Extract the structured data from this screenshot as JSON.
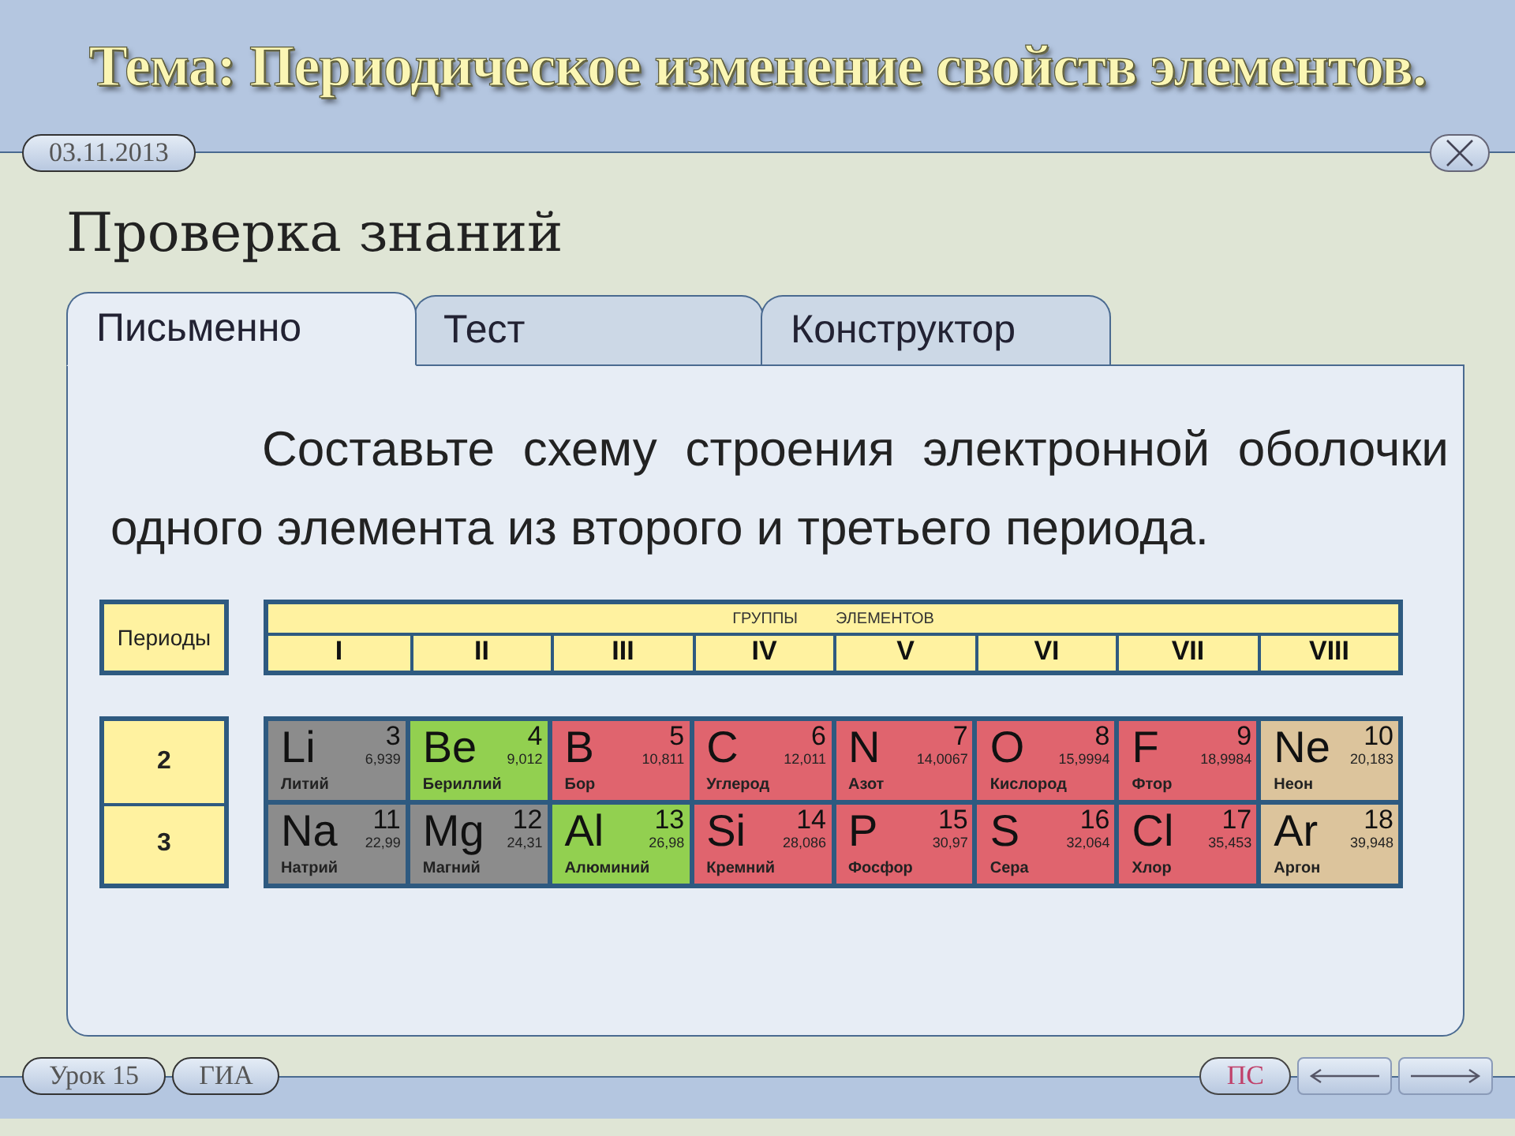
{
  "header": {
    "title": "Тема: Периодическое изменение свойств элементов.",
    "date": "03.11.2013"
  },
  "heading": "Проверка знаний",
  "tabs": [
    {
      "label": "Письменно",
      "selected": true
    },
    {
      "label": "Тест",
      "selected": false
    },
    {
      "label": "Конструктор",
      "selected": false
    }
  ],
  "task": "Составьте схему строения электронной оболочки одного элемента из второго и третьего периода.",
  "table": {
    "periods_label": "Периоды",
    "groups_title": [
      "ГРУППЫ",
      "ЭЛЕМЕНТОВ"
    ],
    "groups": [
      "I",
      "II",
      "III",
      "IV",
      "V",
      "VI",
      "VII",
      "VIII"
    ],
    "periods": [
      "2",
      "3"
    ],
    "elements": [
      [
        {
          "symbol": "Li",
          "number": "3",
          "mass": "6,939",
          "name": "Литий",
          "color": "#8c8c8c"
        },
        {
          "symbol": "Be",
          "number": "4",
          "mass": "9,012",
          "name": "Бериллий",
          "color": "#92d050"
        },
        {
          "symbol": "B",
          "number": "5",
          "mass": "10,811",
          "name": "Бор",
          "color": "#e0646e"
        },
        {
          "symbol": "C",
          "number": "6",
          "mass": "12,011",
          "name": "Углерод",
          "color": "#e0646e"
        },
        {
          "symbol": "N",
          "number": "7",
          "mass": "14,0067",
          "name": "Азот",
          "color": "#e0646e"
        },
        {
          "symbol": "O",
          "number": "8",
          "mass": "15,9994",
          "name": "Кислород",
          "color": "#e0646e"
        },
        {
          "symbol": "F",
          "number": "9",
          "mass": "18,9984",
          "name": "Фтор",
          "color": "#e0646e"
        },
        {
          "symbol": "Ne",
          "number": "10",
          "mass": "20,183",
          "name": "Неон",
          "color": "#dcc49c"
        }
      ],
      [
        {
          "symbol": "Na",
          "number": "11",
          "mass": "22,99",
          "name": "Натрий",
          "color": "#8c8c8c"
        },
        {
          "symbol": "Mg",
          "number": "12",
          "mass": "24,31",
          "name": "Магний",
          "color": "#8c8c8c"
        },
        {
          "symbol": "Al",
          "number": "13",
          "mass": "26,98",
          "name": "Алюминий",
          "color": "#92d050"
        },
        {
          "symbol": "Si",
          "number": "14",
          "mass": "28,086",
          "name": "Кремний",
          "color": "#e0646e"
        },
        {
          "symbol": "P",
          "number": "15",
          "mass": "30,97",
          "name": "Фосфор",
          "color": "#e0646e"
        },
        {
          "symbol": "S",
          "number": "16",
          "mass": "32,064",
          "name": "Сера",
          "color": "#e0646e"
        },
        {
          "symbol": "Cl",
          "number": "17",
          "mass": "35,453",
          "name": "Хлор",
          "color": "#e0646e"
        },
        {
          "symbol": "Ar",
          "number": "18",
          "mass": "39,948",
          "name": "Аргон",
          "color": "#dcc49c"
        }
      ]
    ]
  },
  "footer": {
    "lesson": "Урок 15",
    "exam": "ГИА",
    "ps": "ПС"
  }
}
